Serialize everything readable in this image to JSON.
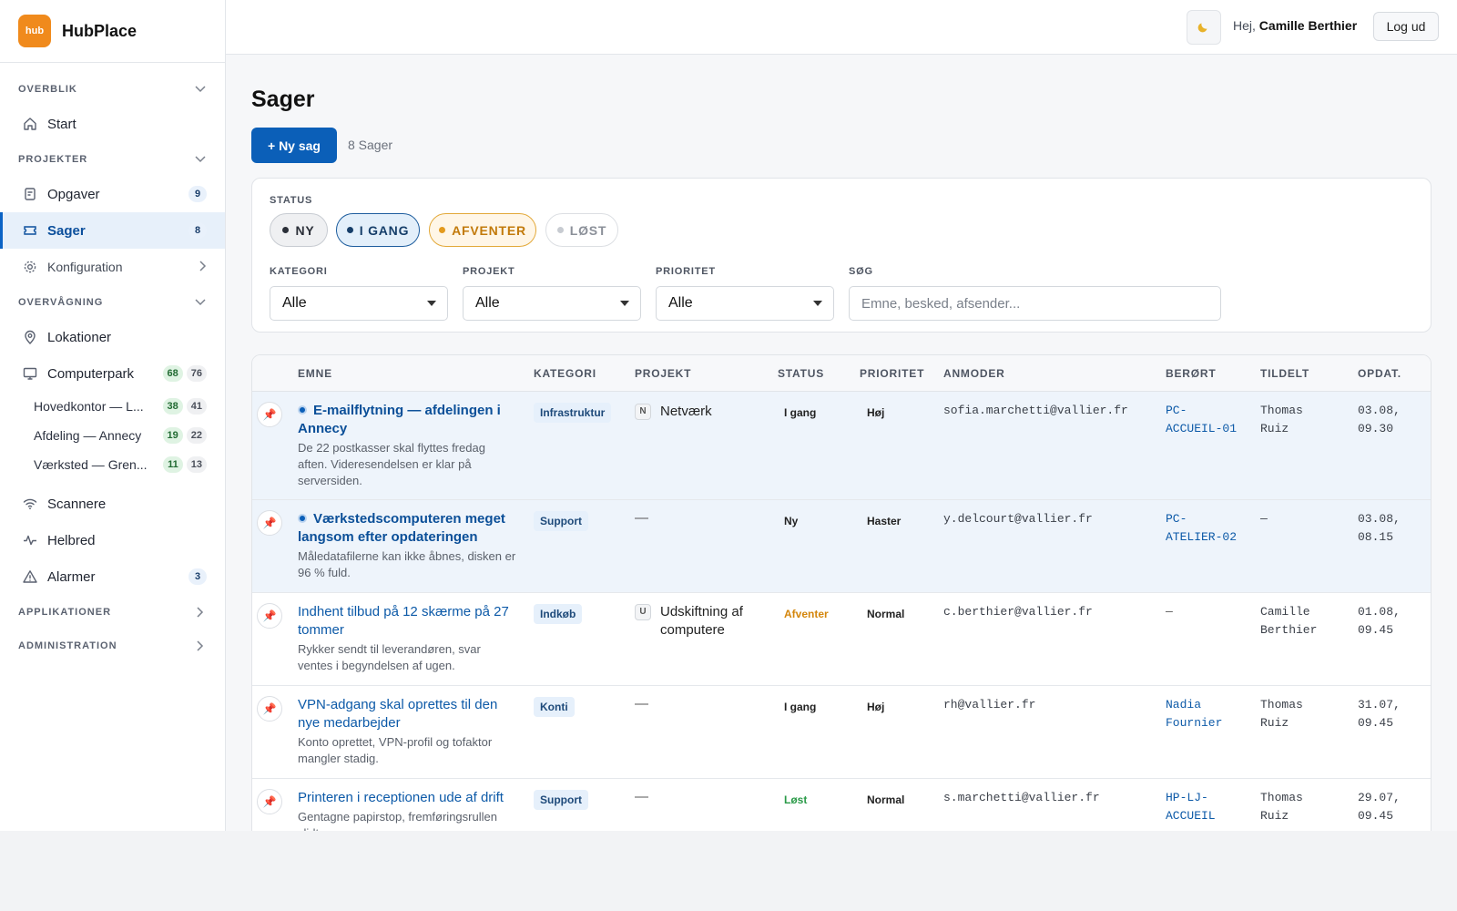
{
  "brand": {
    "logo_text": "hub",
    "name": "HubPlace"
  },
  "topbar": {
    "theme_icon": "moon-icon",
    "greeting": "Hej,",
    "user": "Camille Berthier",
    "logout": "Log ud"
  },
  "sidebar": {
    "overview": {
      "title": "OVERBLIK",
      "items": [
        {
          "label": "Start"
        }
      ]
    },
    "projects": {
      "title": "PROJEKTER",
      "items": [
        {
          "label": "Opgaver",
          "badge": "9"
        },
        {
          "label": "Sager",
          "badge": "8"
        },
        {
          "label": "Konfiguration"
        }
      ]
    },
    "monitoring": {
      "title": "OVERVÅGNING",
      "items": [
        {
          "label": "Lokationer"
        },
        {
          "label": "Computerpark",
          "badge_a": "68",
          "badge_b": "76"
        },
        {
          "label": "Scannere"
        },
        {
          "label": "Helbred"
        },
        {
          "label": "Alarmer",
          "badge": "3"
        }
      ],
      "subitems": [
        {
          "label": "Hovedkontor — L...",
          "badge_a": "38",
          "badge_b": "41"
        },
        {
          "label": "Afdeling — Annecy",
          "badge_a": "19",
          "badge_b": "22"
        },
        {
          "label": "Værksted — Gren...",
          "badge_a": "11",
          "badge_b": "13"
        }
      ]
    },
    "applications": {
      "title": "APPLIKATIONER"
    },
    "administration": {
      "title": "ADMINISTRATION"
    }
  },
  "page": {
    "title": "Sager",
    "new_button": "+ Ny sag",
    "count": "8 Sager"
  },
  "filters": {
    "status_label": "STATUS",
    "status_pills": [
      "NY",
      "I GANG",
      "AFVENTER",
      "LØST"
    ],
    "category": {
      "label": "KATEGORI",
      "value": "Alle"
    },
    "project": {
      "label": "PROJEKT",
      "value": "Alle"
    },
    "priority": {
      "label": "PRIORITET",
      "value": "Alle"
    },
    "search": {
      "label": "SØG",
      "placeholder": "Emne, besked, afsender..."
    }
  },
  "table": {
    "columns": [
      "EMNE",
      "KATEGORI",
      "PROJEKT",
      "STATUS",
      "PRIORITET",
      "ANMODER",
      "BERØRT",
      "TILDELT",
      "OPDAT."
    ],
    "rows": [
      {
        "title": "E-mailflytning — afdelingen i Annecy",
        "desc": "De 22 postkasser skal flyttes fredag aften. Videresendelsen er klar på serversiden.",
        "category": "Infrastruktur",
        "project_badge": "N",
        "project": "Netværk",
        "status": "I gang",
        "priority": "Høj",
        "requester": "sofia.marchetti@vallier.fr",
        "affected": "PC-ACCUEIL-01",
        "assigned": "Thomas Ruiz",
        "updated": "03.08, 09.30"
      },
      {
        "title": "Værkstedscomputeren meget langsom efter opdateringen",
        "desc": "Måledatafilerne kan ikke åbnes, disken er 96 % fuld.",
        "category": "Support",
        "project": "—",
        "status": "Ny",
        "priority": "Haster",
        "requester": "y.delcourt@vallier.fr",
        "affected": "PC-ATELIER-02",
        "assigned": "—",
        "updated": "03.08, 08.15"
      },
      {
        "title": "Indhent tilbud på 12 skærme på 27 tommer",
        "desc": "Rykker sendt til leverandøren, svar ventes i begyndelsen af ugen.",
        "category": "Indkøb",
        "project_badge": "U",
        "project": "Udskiftning af computere",
        "status": "Afventer",
        "priority": "Normal",
        "requester": "c.berthier@vallier.fr",
        "affected": "—",
        "assigned": "Camille Berthier",
        "updated": "01.08, 09.45"
      },
      {
        "title": "VPN-adgang skal oprettes til den nye medarbejder",
        "desc": "Konto oprettet, VPN-profil og tofaktor mangler stadig.",
        "category": "Konti",
        "project": "—",
        "status": "I gang",
        "priority": "Høj",
        "requester": "rh@vallier.fr",
        "affected": "Nadia Fournier",
        "assigned": "Thomas Ruiz",
        "updated": "31.07, 09.45"
      },
      {
        "title": "Printeren i receptionen ude af drift",
        "desc": "Gentagne papirstop, fremføringsrullen slidt.",
        "category": "Support",
        "project": "—",
        "status": "Løst",
        "priority": "Normal",
        "requester": "s.marchetti@vallier.fr",
        "affected": "HP-LJ-ACCUEIL",
        "assigned": "Thomas Ruiz",
        "updated": "29.07, 09.45"
      }
    ]
  }
}
